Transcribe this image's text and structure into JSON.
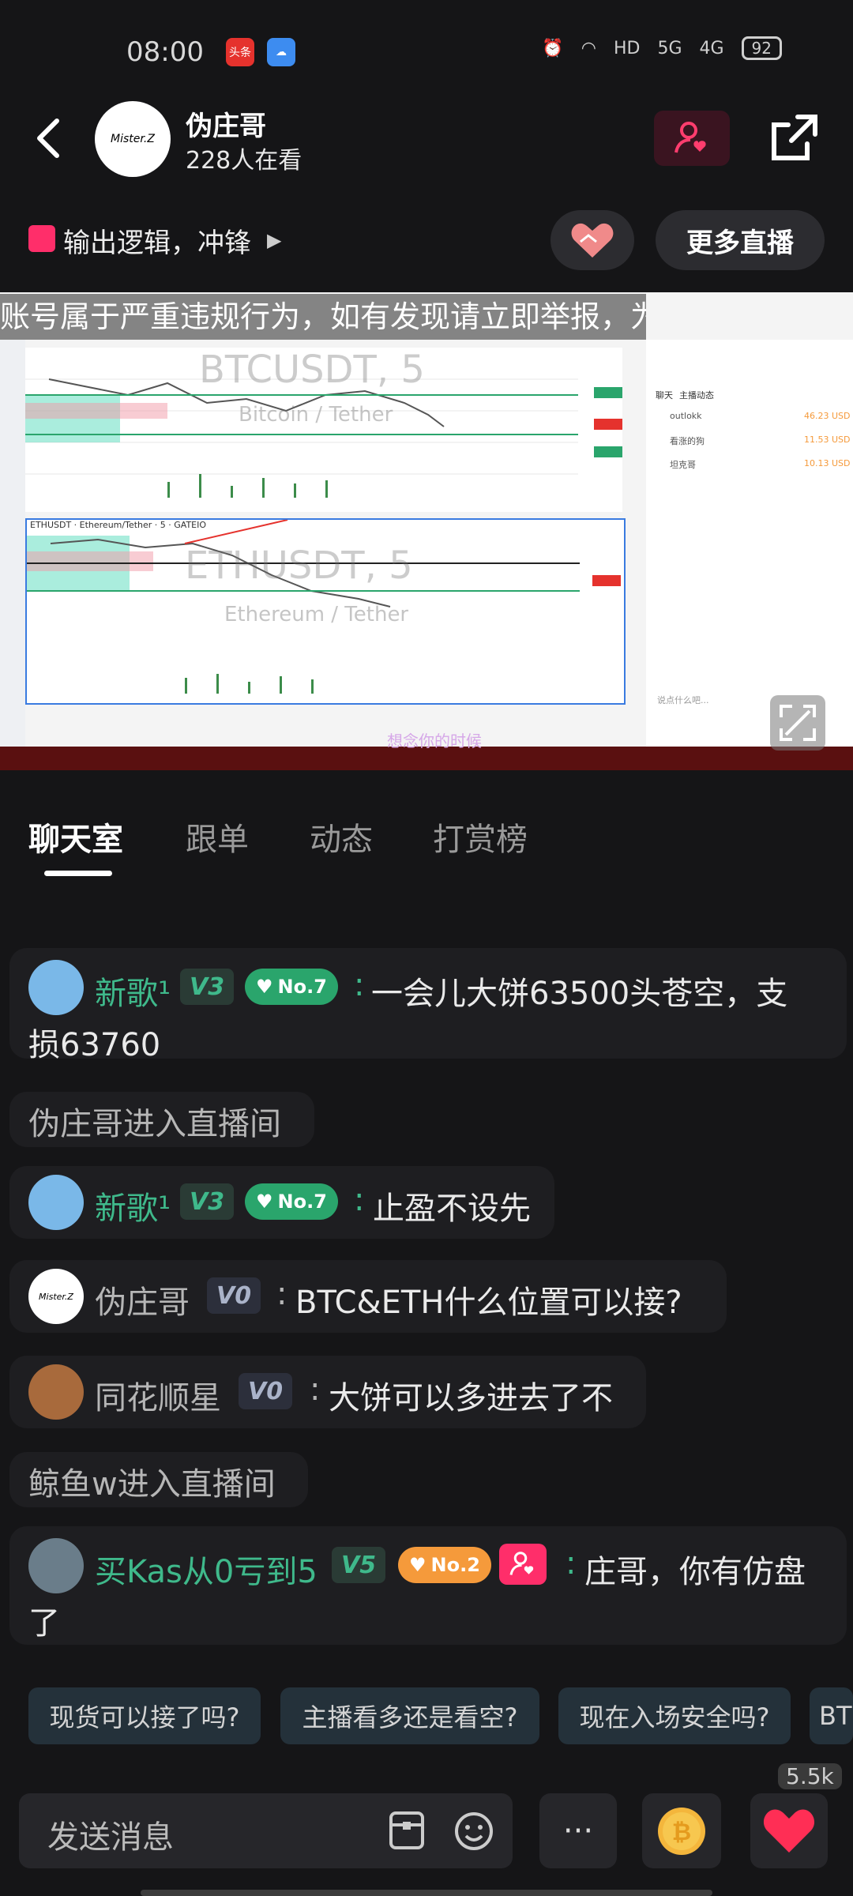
{
  "status_bar": {
    "time": "08:00",
    "app_badge_1": "头条",
    "network_label_1": "5G",
    "network_label_2": "4G",
    "hd_label": "HD",
    "battery": "92"
  },
  "header": {
    "avatar_text": "Mister.Z",
    "host_name": "伪庄哥",
    "viewers": "228人在看"
  },
  "topic": {
    "text": "输出逻辑，冲锋",
    "more_live_label": "更多直播"
  },
  "video": {
    "marquee": "账号属于严重违规行为，如有发现请立即举报，为了您的隐私",
    "chart1_title": "BTCUSDT, 5",
    "chart1_sub": "Bitcoin / Tether",
    "chart2_title": "ETHUSDT, 5",
    "chart2_sub": "Ethereum / Tether",
    "chart2_header": "ETHUSDT · Ethereum/Tether · 5 · GATEIO",
    "right_tabs": [
      "聊天",
      "主播动态"
    ],
    "right_list": [
      {
        "name": "outlokk",
        "val": "46.23 USD"
      },
      {
        "name": "看涨的狗",
        "val": "11.53 USD"
      },
      {
        "name": "坦克哥",
        "val": "10.13 USD"
      }
    ],
    "right_input_ph": "说点什么吧...",
    "taskbar_text": "想念你的时候"
  },
  "tabs": [
    "聊天室",
    "跟单",
    "动态",
    "打赏榜"
  ],
  "chat": [
    {
      "type": "msg",
      "user": "新歌¹",
      "level": "V3",
      "rank": "No.7",
      "text": "一会儿大饼63500头苍空，支",
      "text2": "损63760"
    },
    {
      "type": "sys",
      "text": "伪庄哥进入直播间"
    },
    {
      "type": "msg",
      "user": "新歌¹",
      "level": "V3",
      "rank": "No.7",
      "text": "止盈不设先"
    },
    {
      "type": "msg",
      "user": "伪庄哥",
      "level": "V0",
      "text": "BTC&ETH什么位置可以接?"
    },
    {
      "type": "msg",
      "user": "同花顺星",
      "level": "V0",
      "text": "大饼可以多进去了不"
    },
    {
      "type": "sys",
      "text": "鲸鱼w进入直播间"
    },
    {
      "type": "msg",
      "user": "买Kas从0亏到5",
      "level": "V5",
      "rank": "No.2",
      "text": "庄哥，你有仿盘",
      "text2": "了"
    }
  ],
  "quick_replies": [
    "现货可以接了吗?",
    "主播看多还是看空?",
    "现在入场安全吗?",
    "BT"
  ],
  "input": {
    "placeholder": "发送消息",
    "like_count": "5.5k",
    "more": "···"
  },
  "colors": {
    "accent_green": "#3fb98b",
    "rank_green": "#2aa56c",
    "rank_orange": "#f59a3b",
    "heart_red": "#ff2e55"
  }
}
